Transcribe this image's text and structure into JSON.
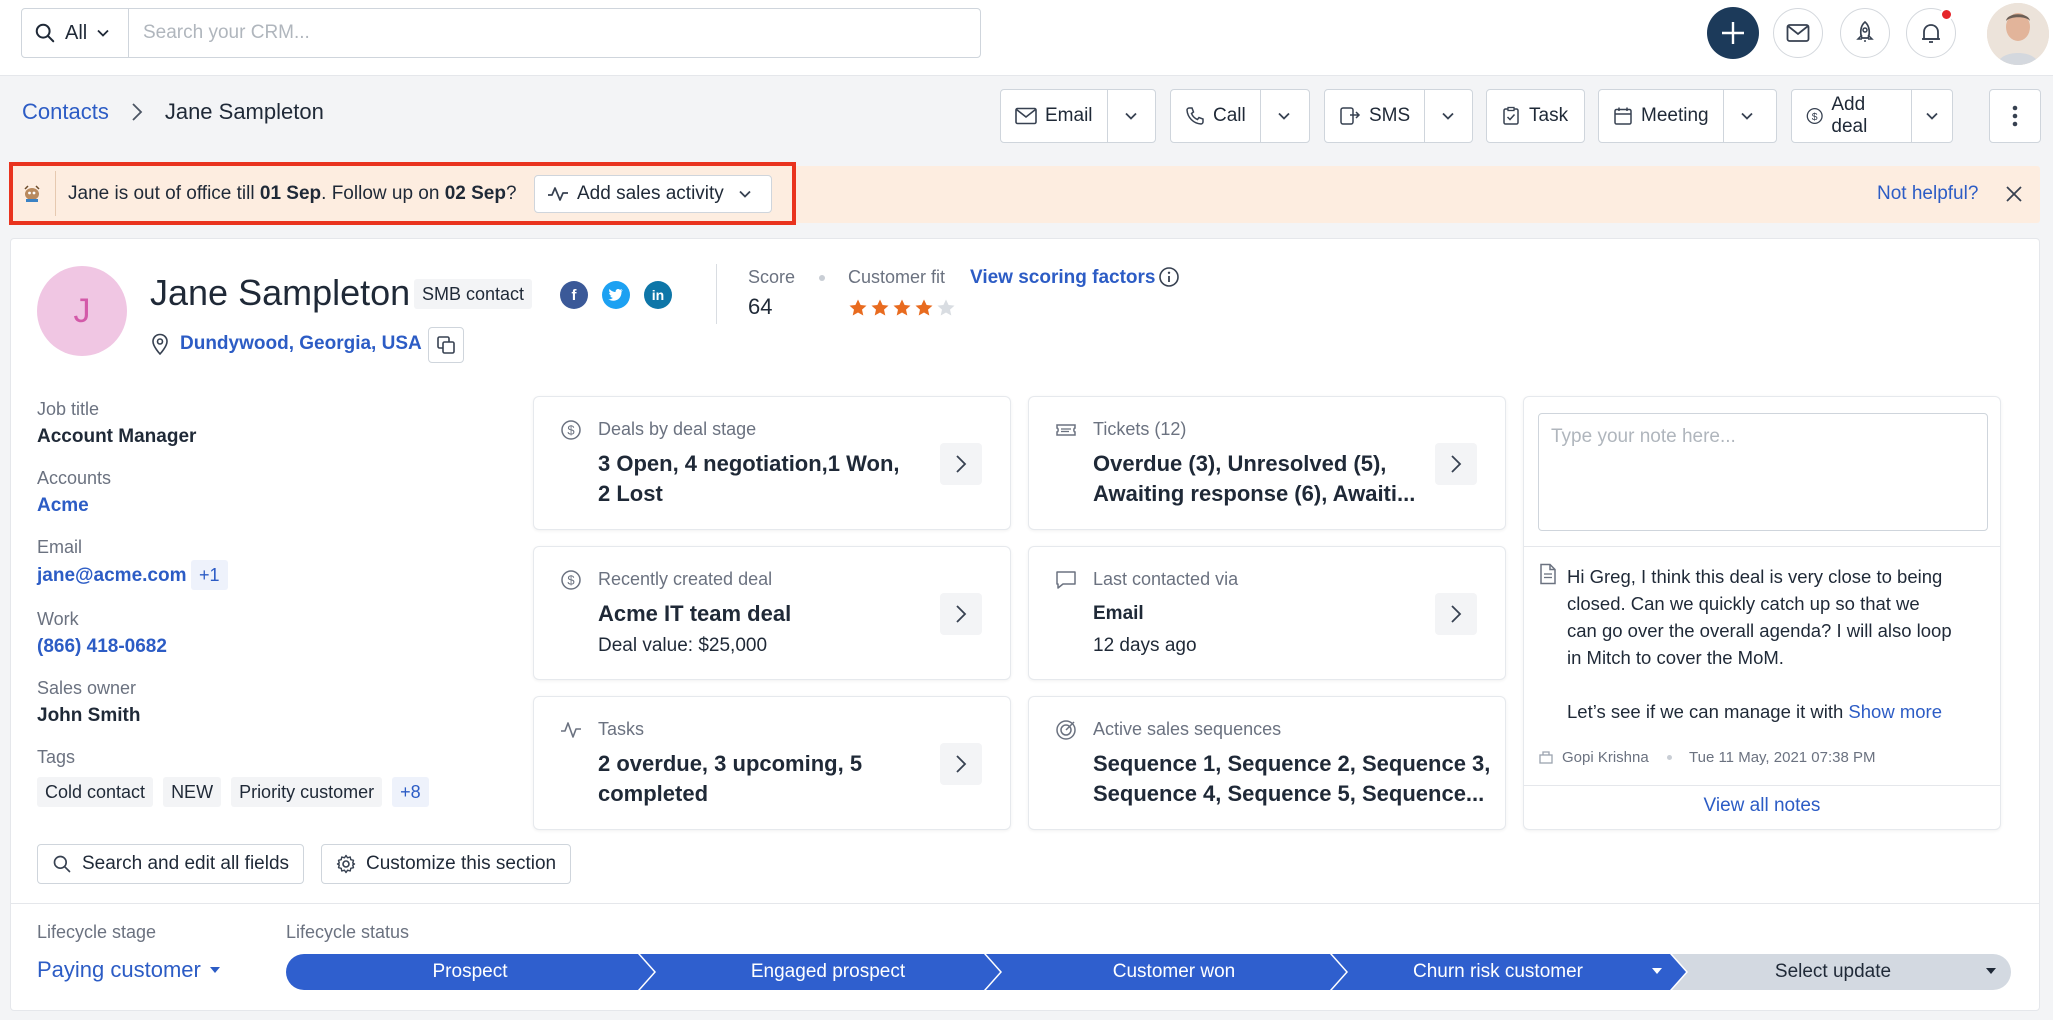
{
  "search": {
    "scope": "All",
    "placeholder": "Search your CRM..."
  },
  "breadcrumb": {
    "root": "Contacts",
    "current": "Jane Sampleton"
  },
  "actions": {
    "email": "Email",
    "call": "Call",
    "sms": "SMS",
    "task": "Task",
    "meeting": "Meeting",
    "add_deal": "Add deal"
  },
  "banner": {
    "text_a": "Jane is out of office till ",
    "date_a": "01 Sep",
    "text_b": ". Follow up on ",
    "date_b": "02 Sep",
    "text_c": "?",
    "add_sales_activity": "Add sales activity",
    "not_helpful": "Not helpful?"
  },
  "contact": {
    "initial": "J",
    "name": "Jane Sampleton",
    "badge": "SMB contact",
    "location": "Dundywood, Georgia, USA",
    "score_label": "Score",
    "score": "64",
    "customer_fit_label": "Customer fit",
    "customer_fit_rating": 4,
    "customer_fit_max": 5,
    "view_scoring": "View scoring factors"
  },
  "fields": {
    "job_title_label": "Job title",
    "job_title": "Account Manager",
    "accounts_label": "Accounts",
    "accounts": "Acme",
    "email_label": "Email",
    "email": "jane@acme.com",
    "email_more": "+1",
    "work_label": "Work",
    "work": "(866) 418-0682",
    "sales_owner_label": "Sales owner",
    "sales_owner": "John Smith",
    "tags_label": "Tags",
    "tags": [
      "Cold contact",
      "NEW",
      "Priority customer"
    ],
    "tags_more": "+8"
  },
  "tiles": {
    "deals": {
      "label": "Deals by deal stage",
      "line1": "3 Open, 4 negotiation,1 Won,",
      "line2": "2 Lost"
    },
    "tickets": {
      "label": "Tickets (12)",
      "line1": "Overdue (3), Unresolved (5),",
      "line2": "Awaiting response (6), Awaiti..."
    },
    "recent_deal": {
      "label": "Recently created deal",
      "value": "Acme IT team deal",
      "sub": "Deal value: $25,000"
    },
    "last_contacted": {
      "label": "Last contacted via",
      "value": "Email",
      "sub": "12 days ago"
    },
    "tasks": {
      "label": "Tasks",
      "line1": "2 overdue, 3 upcoming, 5",
      "line2": "completed"
    },
    "sequences": {
      "label": "Active sales sequences",
      "line1": "Sequence 1, Sequence 2, Sequence 3,",
      "line2": "Sequence 4, Sequence 5, Sequence..."
    }
  },
  "notes": {
    "placeholder": "Type your note here...",
    "lines": [
      "Hi Greg, I think this deal is very close to being",
      "closed. Can we quickly catch up so that we",
      "can go over the overall agenda? I will also loop",
      "in Mitch to cover the MoM."
    ],
    "line_last": "Let’s see if we can manage it with ",
    "show_more": "Show more",
    "author": "Gopi Krishna",
    "timestamp": "Tue 11 May, 2021 07:38 PM",
    "view_all": "View all notes"
  },
  "section_actions": {
    "search_edit": "Search and edit all fields",
    "customize": "Customize this section"
  },
  "lifecycle": {
    "stage_label": "Lifecycle stage",
    "stage_value": "Paying customer",
    "status_label": "Lifecycle status",
    "steps": [
      "Prospect",
      "Engaged prospect",
      "Customer won",
      "Churn risk customer"
    ],
    "select_update": "Select update"
  },
  "colors": {
    "brand_blue": "#2c5cc5",
    "step_blue": "#2f5fce",
    "banner_bg": "#fdede0",
    "highlight_red": "#e9331e",
    "star": "#e86b1f"
  }
}
